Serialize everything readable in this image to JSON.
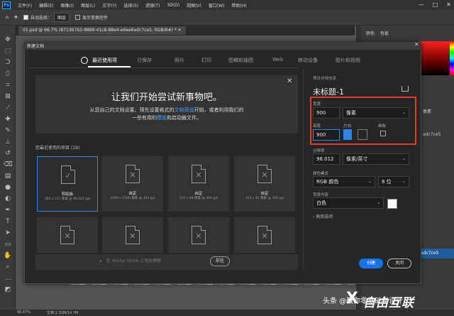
{
  "menu": {
    "logo": "Ps",
    "items": [
      "文件(F)",
      "编辑(E)",
      "图像(I)",
      "图层(L)",
      "文字(Y)",
      "选择(S)",
      "滤镜(T)",
      "3D(D)",
      "视图(V)",
      "窗口(W)",
      "帮助(H)"
    ]
  },
  "window_controls": {
    "minimize": "—",
    "maximize": "□",
    "close": "✕"
  },
  "options_bar": {
    "auto_select_label": "自动选择：",
    "auto_select_value": "图层",
    "show_transform": "显示变换控件"
  },
  "doc_tab": "01.psd @ 66.7% (871367b3-9889-41c8-88e4-e6ee6adc7ce5, RGB/8#) * ✕",
  "right_panel": {
    "tabs": [
      "颜色",
      "色板"
    ],
    "labels": [
      "像素",
      "adc7ce5"
    ],
    "history_item": "adc7ce5"
  },
  "statusbar": {
    "zoom": "66.67%",
    "doc_info": "文档:2.32M/14.7M"
  },
  "dialog": {
    "title": "新建文档",
    "close": "✕",
    "tabs": [
      "最近使用项",
      "已保存",
      "照片",
      "打印",
      "图稿和插图",
      "Web",
      "移动设备",
      "胶片和视频"
    ],
    "banner": {
      "heading": "让我们开始尝试新事物吧。",
      "desc_pre": "从您自己的文档设置、预先设置格式的",
      "desc_link": "文档预设",
      "desc_post": "开始，或者利用我们的",
      "desc2_pre": "一些有用的",
      "desc2_link": "模板",
      "desc2_post": "和启动器文件。",
      "close": "✕"
    },
    "recent_label": "您最近使用的项目  (19)",
    "recent_items": [
      {
        "name": "剪贴板",
        "size": "164 x 157 像素 @ 96.012 ppi",
        "glyph": "✓"
      },
      {
        "name": "自定",
        "size": "1000 x 1500 像素 @ 300 ppi",
        "glyph": "✕"
      },
      {
        "name": "自定",
        "size": "116 x 48 像素 @ 300 ppi",
        "glyph": "✕"
      },
      {
        "name": "自定",
        "size": "119 x 45 像素 @ 300 ppi",
        "glyph": "✕"
      },
      {
        "name": "",
        "size": "",
        "glyph": "✕"
      },
      {
        "name": "",
        "size": "",
        "glyph": "✕"
      },
      {
        "name": "",
        "size": "",
        "glyph": "✕"
      },
      {
        "name": "",
        "size": "",
        "glyph": "✕"
      }
    ],
    "stock_search": {
      "icon": "⌕",
      "placeholder": "在 Adobe Stock 上查找模板",
      "button": "前往"
    },
    "details": {
      "section_label": "预设详细信息",
      "doc_name": "未标题-1",
      "width_label": "宽度",
      "width_value": "900",
      "width_unit": "像素",
      "height_label": "高度",
      "height_value": "900",
      "orientation_label": "方向",
      "artboard_label": "画板",
      "resolution_label": "分辨率",
      "resolution_value": "96.012",
      "resolution_unit": "像素/英寸",
      "color_mode_label": "颜色模式",
      "color_mode_value": "RGB 颜色",
      "bit_depth": "8 位",
      "background_label": "背景内容",
      "background_value": "白色",
      "background_color": "#ffffff",
      "advanced": "› 高级选项",
      "dropdown_arrow": "⌄"
    },
    "buttons": {
      "create": "创建",
      "close": "关闭"
    }
  },
  "watermark": {
    "credit": "头条 @教你零基础学设计",
    "brand": "自由互联",
    "mark": "X"
  },
  "colors": {
    "accent": "#1473e6",
    "highlight": "#e33a2f",
    "link": "#4aa3ff"
  }
}
